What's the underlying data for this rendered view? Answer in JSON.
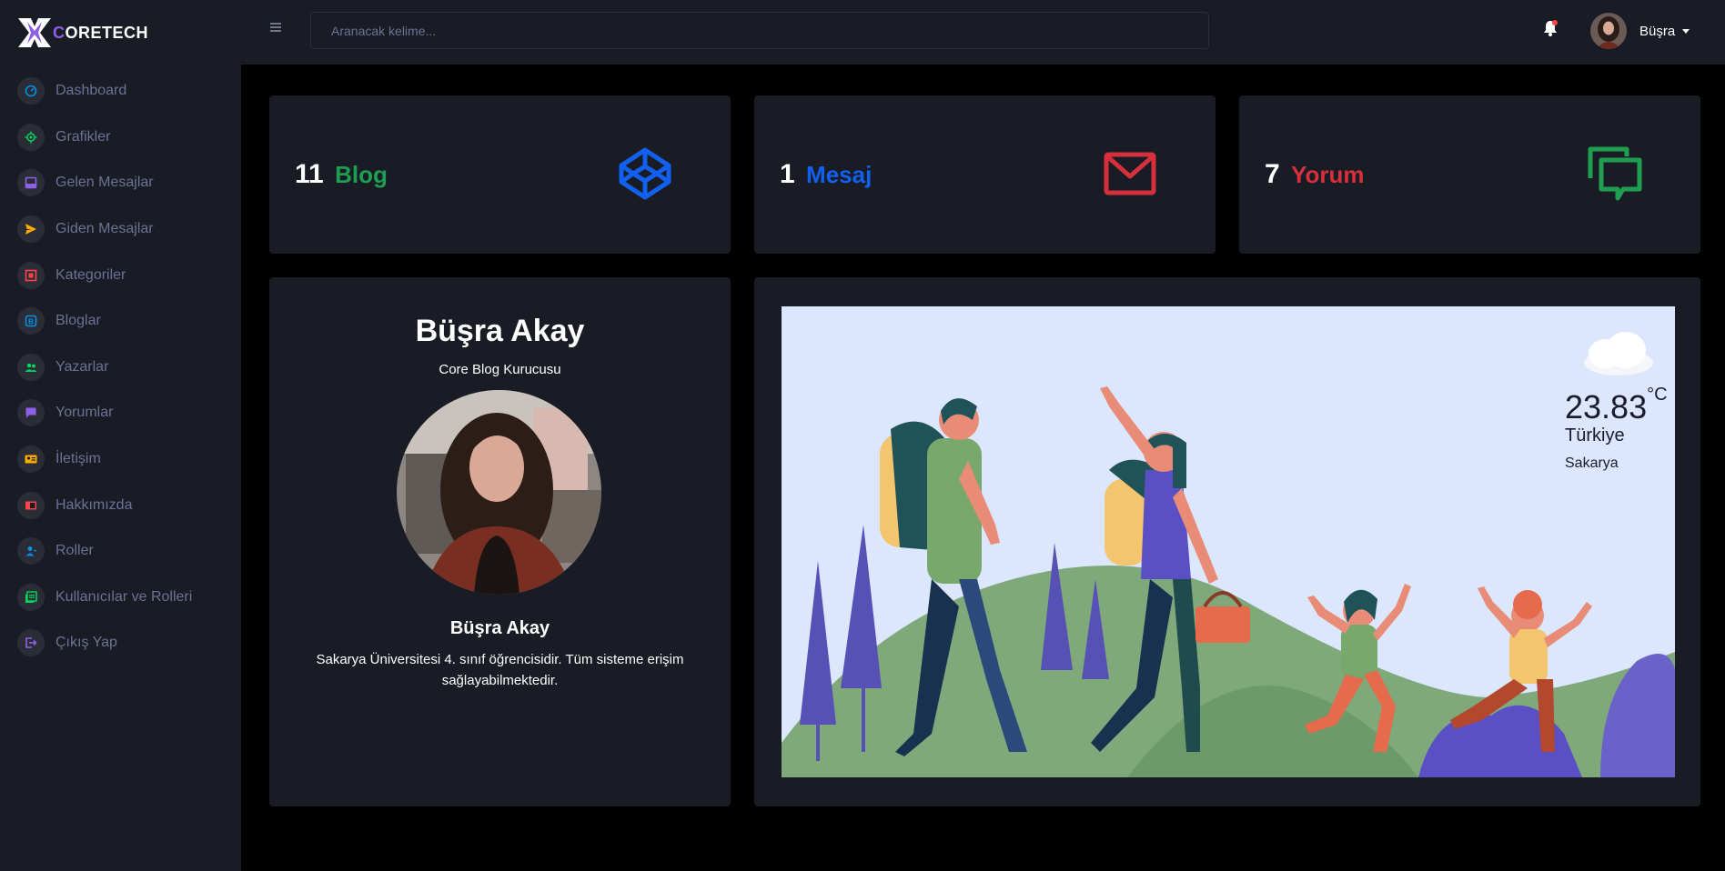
{
  "brand": {
    "first_letter": "C",
    "rest": "ORETECH"
  },
  "nav": [
    {
      "label": "Dashboard",
      "icon": "speedometer-icon",
      "color": "#0090e7"
    },
    {
      "label": "Grafikler",
      "icon": "chart-icon",
      "color": "#00d25b"
    },
    {
      "label": "Gelen Mesajlar",
      "icon": "inbox-icon",
      "color": "#8f5fe8"
    },
    {
      "label": "Giden Mesajlar",
      "icon": "send-icon",
      "color": "#ffab00"
    },
    {
      "label": "Kategoriler",
      "icon": "category-icon",
      "color": "#fc424a"
    },
    {
      "label": "Bloglar",
      "icon": "blog-icon",
      "color": "#0090e7"
    },
    {
      "label": "Yazarlar",
      "icon": "users-icon",
      "color": "#00d25b"
    },
    {
      "label": "Yorumlar",
      "icon": "comment-icon",
      "color": "#8f5fe8"
    },
    {
      "label": "İletişim",
      "icon": "contact-card-icon",
      "color": "#ffab00"
    },
    {
      "label": "Hakkımızda",
      "icon": "about-icon",
      "color": "#fc424a"
    },
    {
      "label": "Roller",
      "icon": "role-icon",
      "color": "#0090e7"
    },
    {
      "label": "Kullanıcılar ve Rolleri",
      "icon": "user-list-icon",
      "color": "#00d25b"
    },
    {
      "label": "Çıkış Yap",
      "icon": "logout-icon",
      "color": "#8f5fe8"
    }
  ],
  "search": {
    "placeholder": "Aranacak kelime..."
  },
  "user": {
    "name": "Büşra"
  },
  "stats": [
    {
      "count": "11",
      "label": "Blog",
      "color": "#1e9e4f",
      "icon": "codepen-icon",
      "icon_color": "#1160ef"
    },
    {
      "count": "1",
      "label": "Mesaj",
      "color": "#1160ef",
      "icon": "envelope-icon",
      "icon_color": "#d5303b"
    },
    {
      "count": "7",
      "label": "Yorum",
      "color": "#d5303b",
      "icon": "chat-icon",
      "icon_color": "#1e9e4f"
    }
  ],
  "profile": {
    "title": "Büşra Akay",
    "subtitle": "Core Blog Kurucusu",
    "name": "Büşra Akay",
    "description": "Sakarya Üniversitesi 4. sınıf öğrencisidir. Tüm sisteme erişim sağlayabilmektedir."
  },
  "weather": {
    "temperature": "23.83",
    "unit": "°C",
    "country": "Türkiye",
    "city": "Sakarya"
  }
}
